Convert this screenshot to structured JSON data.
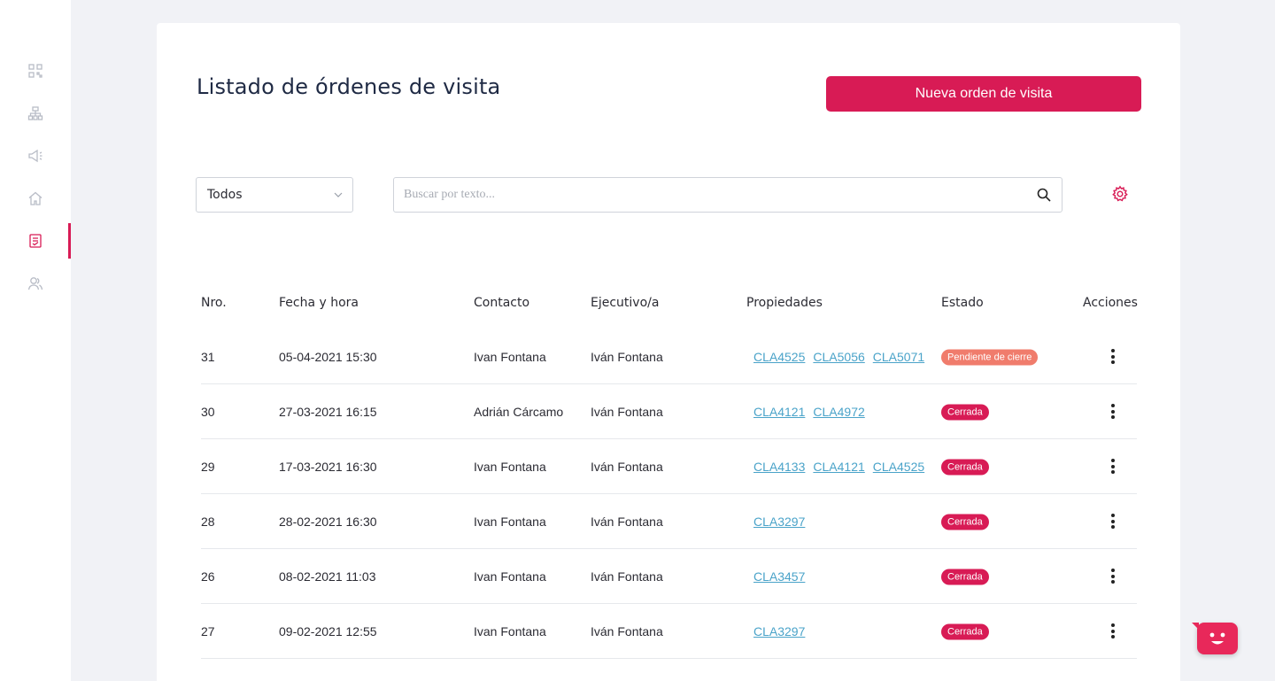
{
  "colors": {
    "accent": "#d81b55",
    "link": "#4aa3c9",
    "pending": "#f07c6c",
    "closed": "#d81b55"
  },
  "sidebar": {
    "items": [
      {
        "name": "qr-icon",
        "active": false
      },
      {
        "name": "org-chart-icon",
        "active": false
      },
      {
        "name": "megaphone-icon",
        "active": false
      },
      {
        "name": "home-icon",
        "active": false
      },
      {
        "name": "clipboard-icon",
        "active": true
      },
      {
        "name": "users-icon",
        "active": false
      }
    ]
  },
  "header": {
    "title": "Listado de órdenes de visita",
    "new_button_label": "Nueva orden de visita"
  },
  "filters": {
    "status_selected": "Todos",
    "search_placeholder": "Buscar por texto..."
  },
  "table": {
    "headers": {
      "nro": "Nro.",
      "fecha": "Fecha y hora",
      "contacto": "Contacto",
      "ejecutivo": "Ejecutivo/a",
      "propiedades": "Propiedades",
      "estado": "Estado",
      "acciones": "Acciones"
    },
    "rows": [
      {
        "nro": "31",
        "fecha": "05-04-2021 15:30",
        "contacto": "Ivan Fontana",
        "ejecutivo": "Iván Fontana",
        "propiedades": [
          "CLA4525",
          "CLA5056",
          "CLA5071"
        ],
        "estado": "Pendiente de cierre",
        "estado_type": "pending"
      },
      {
        "nro": "30",
        "fecha": "27-03-2021 16:15",
        "contacto": "Adrián Cárcamo",
        "ejecutivo": "Iván Fontana",
        "propiedades": [
          "CLA4121",
          "CLA4972"
        ],
        "estado": "Cerrada",
        "estado_type": "closed"
      },
      {
        "nro": "29",
        "fecha": "17-03-2021 16:30",
        "contacto": "Ivan Fontana",
        "ejecutivo": "Iván Fontana",
        "propiedades": [
          "CLA4133",
          "CLA4121",
          "CLA4525"
        ],
        "estado": "Cerrada",
        "estado_type": "closed"
      },
      {
        "nro": "28",
        "fecha": "28-02-2021 16:30",
        "contacto": "Ivan Fontana",
        "ejecutivo": "Iván Fontana",
        "propiedades": [
          "CLA3297"
        ],
        "estado": "Cerrada",
        "estado_type": "closed"
      },
      {
        "nro": "26",
        "fecha": "08-02-2021 11:03",
        "contacto": "Ivan Fontana",
        "ejecutivo": "Iván Fontana",
        "propiedades": [
          "CLA3457"
        ],
        "estado": "Cerrada",
        "estado_type": "closed"
      },
      {
        "nro": "27",
        "fecha": "09-02-2021 12:55",
        "contacto": "Ivan Fontana",
        "ejecutivo": "Iván Fontana",
        "propiedades": [
          "CLA3297"
        ],
        "estado": "Cerrada",
        "estado_type": "closed"
      }
    ]
  },
  "chat_widget": {
    "icon": "chat-face-icon"
  }
}
